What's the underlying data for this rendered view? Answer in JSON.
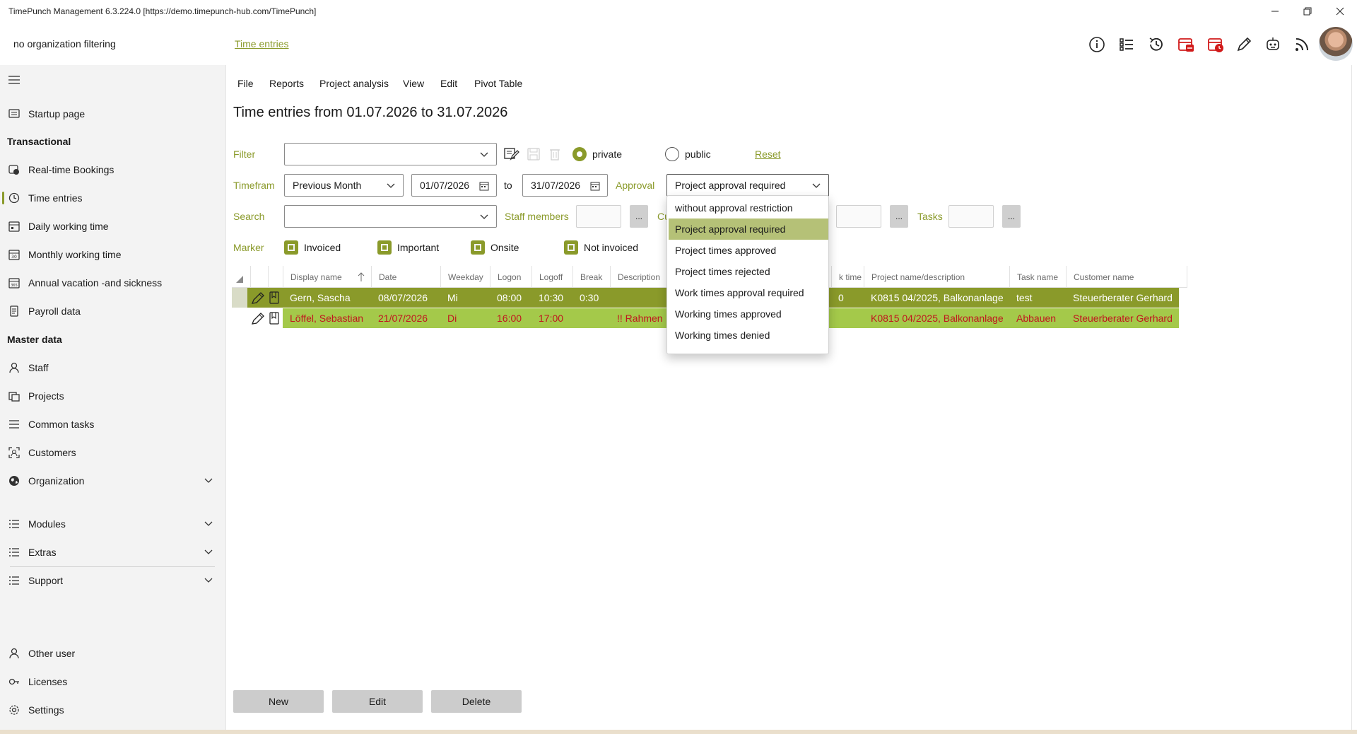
{
  "window": {
    "title": "TimePunch Management 6.3.224.0 [https://demo.timepunch-hub.com/TimePunch]"
  },
  "header": {
    "org_filter": "no organization filtering",
    "breadcrumb": "Time entries",
    "icons": [
      "info-icon",
      "list-icon",
      "history-icon",
      "calendar-alert-icon",
      "calendar-clock-icon",
      "pencil-icon",
      "robot-icon",
      "rss-icon"
    ]
  },
  "sidebar": {
    "items": [
      {
        "label": "Startup page",
        "icon": "monitor-icon"
      },
      {
        "label": "Real-time Bookings",
        "icon": "realtime-icon"
      },
      {
        "label": "Time entries",
        "icon": "clock-icon",
        "active": true
      },
      {
        "label": "Daily working time",
        "icon": "calendar-day-icon"
      },
      {
        "label": "Monthly working time",
        "icon": "calendar-month-icon"
      },
      {
        "label": "Annual vacation -and sickness",
        "icon": "calendar-year-icon"
      },
      {
        "label": "Payroll data",
        "icon": "document-icon"
      },
      {
        "label": "Staff",
        "icon": "person-icon"
      },
      {
        "label": "Projects",
        "icon": "projects-icon"
      },
      {
        "label": "Common tasks",
        "icon": "tasks-icon"
      },
      {
        "label": "Customers",
        "icon": "customers-icon"
      },
      {
        "label": "Organization",
        "icon": "globe-icon"
      },
      {
        "label": "Modules",
        "icon": "list-icon"
      },
      {
        "label": "Extras",
        "icon": "list-icon"
      },
      {
        "label": "Support",
        "icon": "list-icon"
      },
      {
        "label": "Other user",
        "icon": "person-icon"
      },
      {
        "label": "Licenses",
        "icon": "key-icon"
      },
      {
        "label": "Settings",
        "icon": "gear-icon"
      }
    ],
    "sections": {
      "transactional": "Transactional",
      "master_data": "Master data"
    }
  },
  "menu": [
    "File",
    "Reports",
    "Project analysis",
    "View",
    "Edit",
    "Pivot Table"
  ],
  "page_title": "Time entries from 01.07.2026 to 31.07.2026",
  "filters": {
    "filter_label": "Filter",
    "filter_value": "",
    "private_label": "private",
    "public_label": "public",
    "visibility_selected": "private",
    "reset_label": "Reset",
    "timeframe_label": "Timefram",
    "timeframe_value": "Previous Month",
    "date_from": "01/07/2026",
    "to_label": "to",
    "date_to": "31/07/2026",
    "approval_label": "Approval",
    "approval_value": "Project approval required",
    "search_label": "Search",
    "search_value": "",
    "staff_label": "Staff members",
    "customers_label_partial": "Cu",
    "tasks_label": "Tasks",
    "dots": "...",
    "marker_label": "Marker",
    "markers": [
      "Invoiced",
      "Important",
      "Onsite",
      "Not invoiced"
    ]
  },
  "approval_options": [
    "without approval restriction",
    "Project approval required",
    "Project times approved",
    "Project times rejected",
    "Work times approval required",
    "Working times approved",
    "Working times denied"
  ],
  "approval_selected_index": 1,
  "grid": {
    "columns": [
      "Display name",
      "Date",
      "Weekday",
      "Logon",
      "Logoff",
      "Break",
      "Description",
      "k time",
      "Project name/description",
      "Task name",
      "Customer name"
    ],
    "rows": [
      {
        "name": "Gern, Sascha",
        "date": "08/07/2026",
        "weekday": "Mi",
        "logon": "08:00",
        "logoff": "10:30",
        "break": "0:30",
        "description": "",
        "work_time": "0",
        "project": "K0815 04/2025, Balkonanlage",
        "task": "test",
        "customer": "Steuerberater Gerhard"
      },
      {
        "name": "Löffel, Sebastian",
        "date": "21/07/2026",
        "weekday": "Di",
        "logon": "16:00",
        "logoff": "17:00",
        "break": "",
        "description": "!! Rahmen",
        "work_time": "",
        "project": "K0815 04/2025, Balkonanlage",
        "task": "Abbauen",
        "customer": "Steuerberater Gerhard"
      }
    ]
  },
  "buttons": {
    "new": "New",
    "edit": "Edit",
    "delete": "Delete"
  },
  "colors": {
    "accent": "#8a9a2a",
    "row_selected": "#8a9a2a",
    "row_highlight": "#a4c94a",
    "row2_text": "#c0171f",
    "option_selected": "#b5c177"
  }
}
